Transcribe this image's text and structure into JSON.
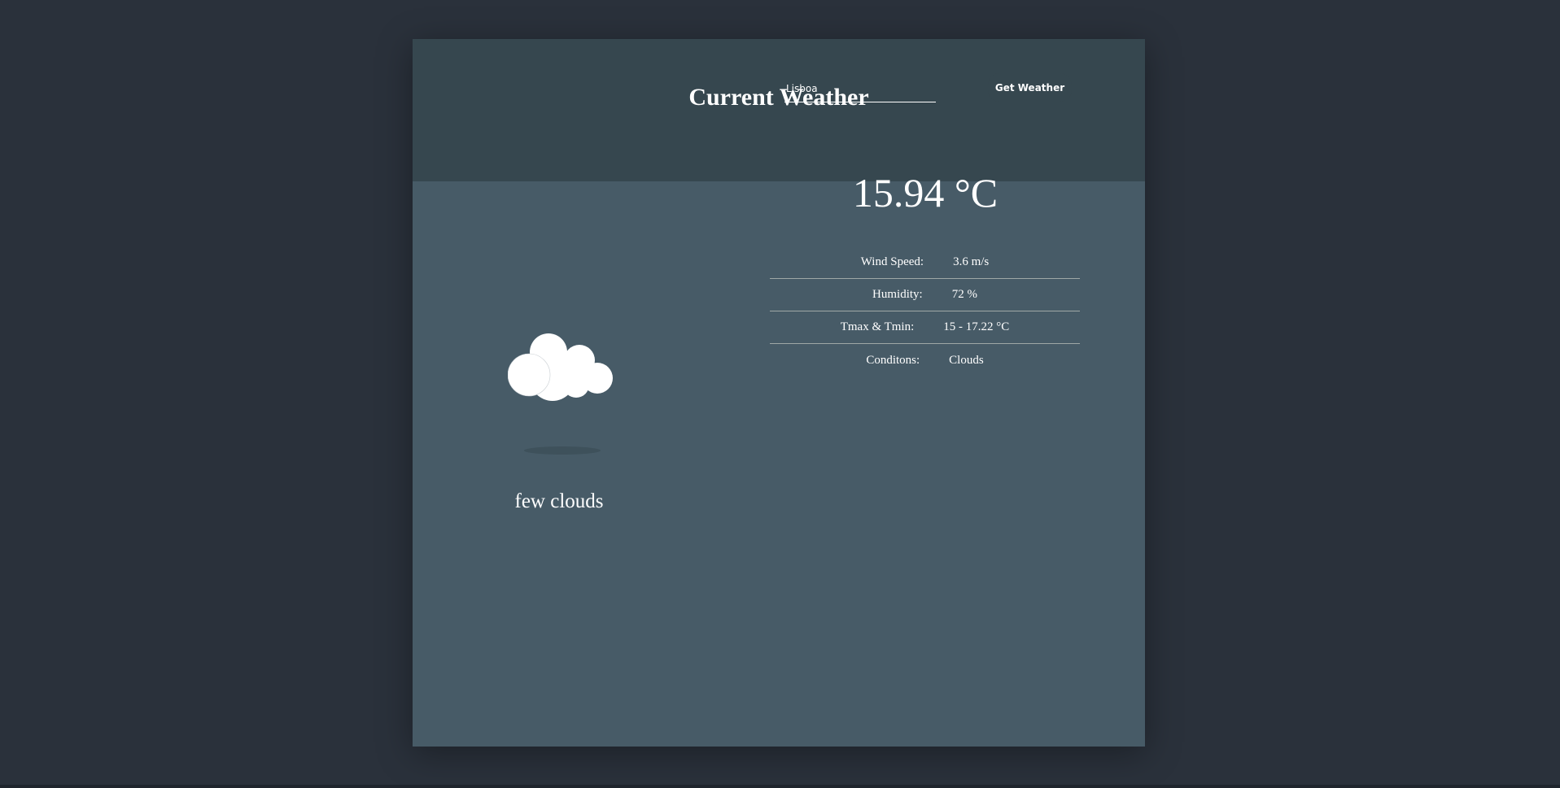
{
  "header": {
    "title": "Current Weather"
  },
  "weather": {
    "icon": "few-clouds-icon",
    "description": "few clouds",
    "temperature": "15.94 °C"
  },
  "search": {
    "city_value": "Lisboa",
    "button_label": "Get Weather"
  },
  "stats": [
    {
      "label": "Wind Speed:",
      "value": "3.6 m/s"
    },
    {
      "label": "Humidity:",
      "value": "72 %"
    },
    {
      "label": "Tmax & Tmin:",
      "value": "15 - 17.22 °C"
    },
    {
      "label": "Conditons:",
      "value": "Clouds"
    }
  ],
  "colors": {
    "page_bg": "#2a313b",
    "header_bg": "#36474f",
    "card_bg": "#475b67",
    "text": "#ffffff"
  }
}
